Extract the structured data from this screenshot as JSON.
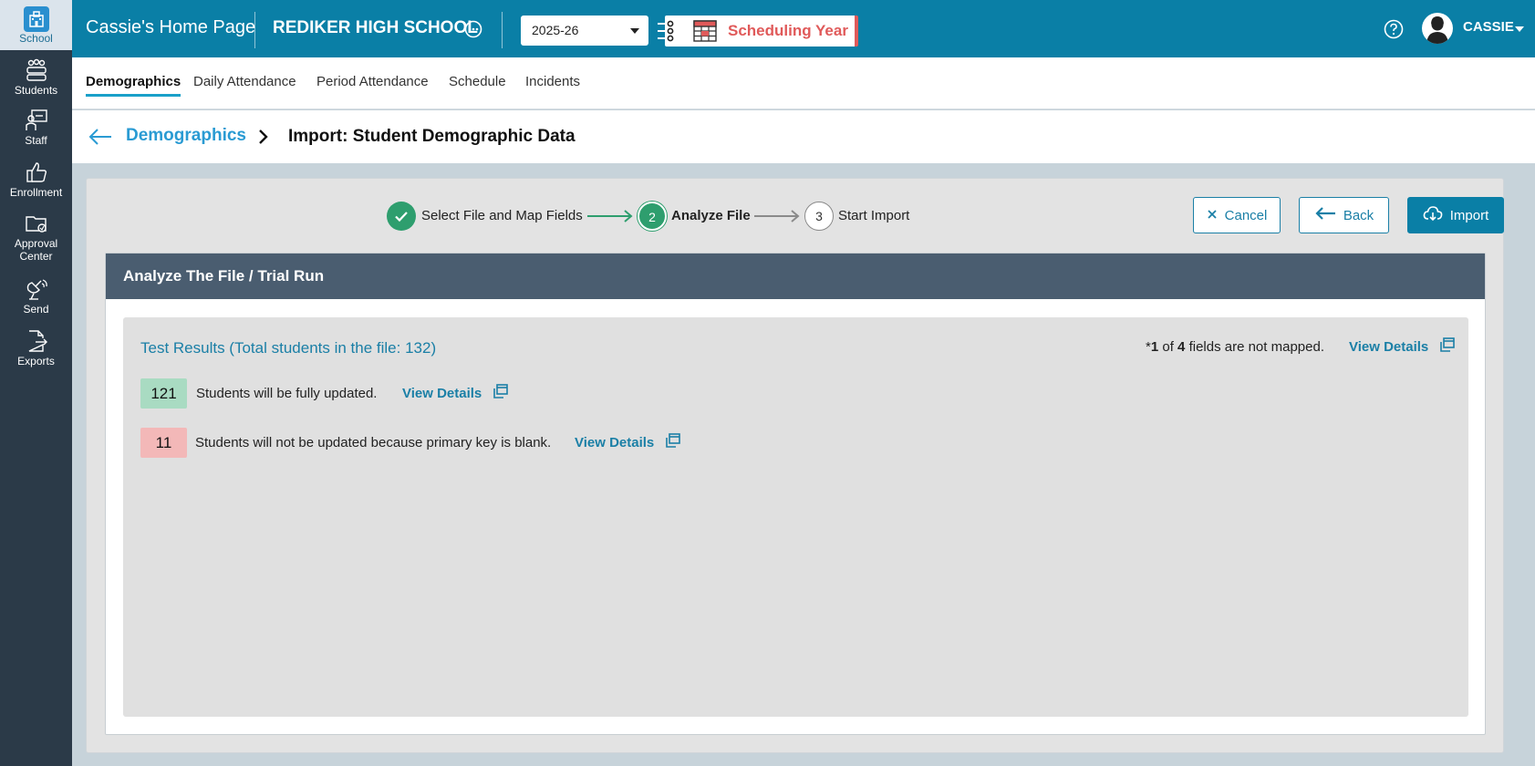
{
  "sidebar": {
    "items": [
      {
        "label": "School",
        "icon": "school-icon"
      },
      {
        "label": "Students",
        "icon": "students-icon"
      },
      {
        "label": "Staff",
        "icon": "staff-icon"
      },
      {
        "label": "Enrollment",
        "icon": "thumbs-up-icon"
      },
      {
        "label": "Approval Center",
        "icon": "folder-icon"
      },
      {
        "label": "Send",
        "icon": "satellite-icon"
      },
      {
        "label": "Exports",
        "icon": "export-file-icon"
      }
    ]
  },
  "header": {
    "home_title": "Cassie's Home Page",
    "school_name": "REDIKER HIGH SCHOOL",
    "year": "2025-26",
    "scheduling_label": "Scheduling Year",
    "user_name": "CASSIE"
  },
  "tabs": [
    "Demographics",
    "Daily Attendance",
    "Period Attendance",
    "Schedule",
    "Incidents"
  ],
  "breadcrumb": {
    "parent": "Demographics",
    "current": "Import: Student Demographic Data"
  },
  "wizard": {
    "steps": [
      {
        "number": "",
        "label": "Select File and Map Fields",
        "state": "done"
      },
      {
        "number": "2",
        "label": "Analyze File",
        "state": "current"
      },
      {
        "number": "3",
        "label": "Start Import",
        "state": "pending"
      }
    ],
    "buttons": {
      "cancel": "Cancel",
      "back": "Back",
      "import": "Import"
    }
  },
  "card": {
    "title": "Analyze The File / Trial Run",
    "results_title": "Test Results (Total students in the file: 132)",
    "mapped": {
      "prefix": "*",
      "count": "1",
      "of": "of",
      "total": "4",
      "suffix": "fields are not mapped."
    },
    "view_details": "View Details",
    "rows": [
      {
        "count": "121",
        "text": "Students will be fully updated.",
        "status": "success"
      },
      {
        "count": "11",
        "text": "Students will not be updated because primary key is blank.",
        "status": "error"
      }
    ]
  },
  "colors": {
    "header": "#0a7fa6",
    "sidebar": "#2b3a48",
    "success": "#2e9e6e",
    "error_badge": "#f3b8b8",
    "success_badge": "#a9dbc2",
    "scheduling": "#e05a5a"
  }
}
